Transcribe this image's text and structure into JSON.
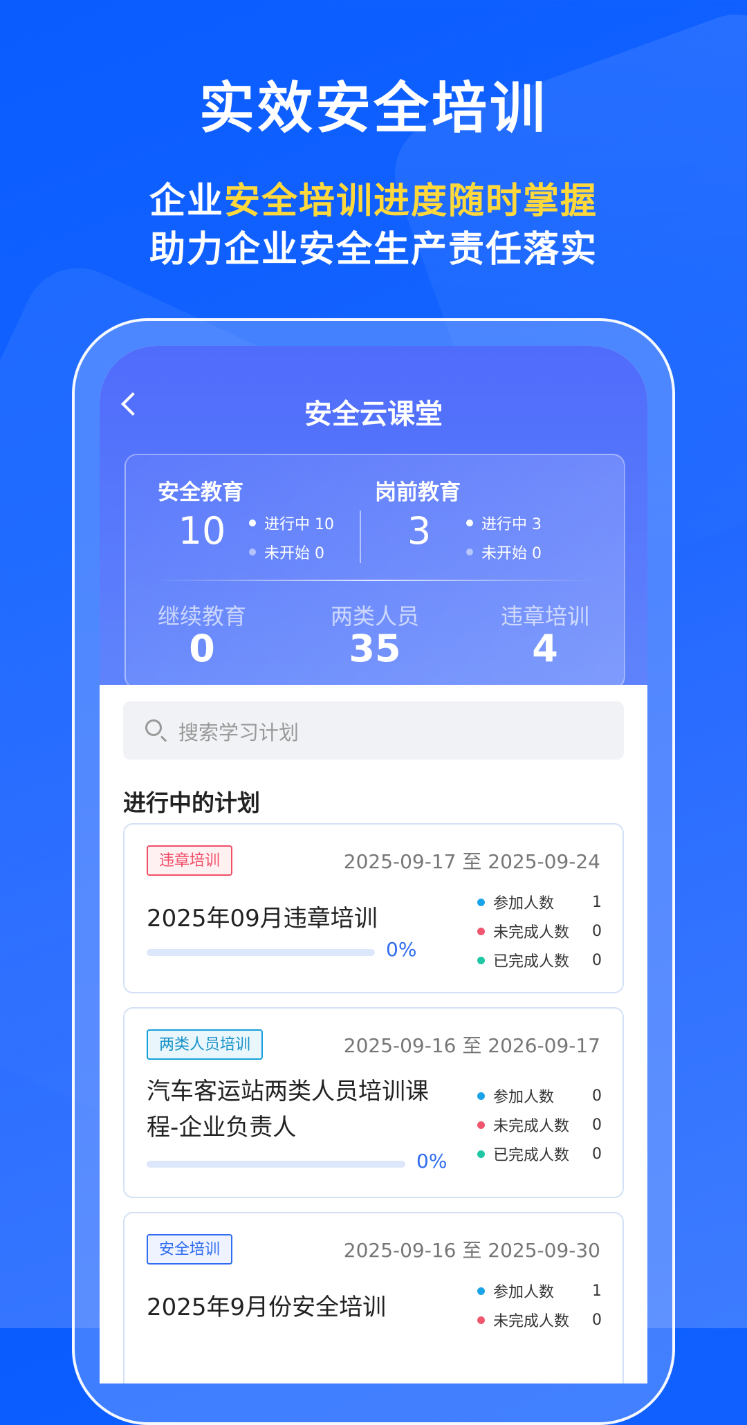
{
  "hero": {
    "title": "实效安全培训",
    "line1_prefix": "企业",
    "line1_highlight": "安全培训进度随时掌握",
    "line2": "助力企业安全生产责任落实",
    "highlight_color": "#ffd93b"
  },
  "app": {
    "title": "安全云课堂",
    "back_icon": "chevron-left-icon"
  },
  "summary": {
    "safety_edu": {
      "label": "安全教育",
      "total": "10",
      "in_progress": "进行中 10",
      "not_started": "未开始 0"
    },
    "pre_job_edu": {
      "label": "岗前教育",
      "total": "3",
      "in_progress": "进行中 3",
      "not_started": "未开始 0"
    },
    "continuing_edu": {
      "label": "继续教育",
      "value": "0"
    },
    "two_types": {
      "label": "两类人员",
      "value": "35"
    },
    "violation": {
      "label": "违章培训",
      "value": "4"
    }
  },
  "search": {
    "placeholder": "搜索学习计划"
  },
  "section_title": "进行中的计划",
  "plans": [
    {
      "tag": "违章培训",
      "dates": "2025-09-17 至 2025-09-24",
      "title_line1": "2025年09月违章培训",
      "title_line2": "",
      "progress_text": "0%",
      "progress": 0,
      "stats": [
        {
          "label": "参加人数",
          "value": "1"
        },
        {
          "label": "未完成人数",
          "value": "0"
        },
        {
          "label": "已完成人数",
          "value": "0"
        }
      ]
    },
    {
      "tag": "两类人员培训",
      "dates": "2025-09-16 至 2026-09-17",
      "title_line1": "汽车客运站两类人员培训课",
      "title_line2": "程-企业负责人",
      "progress_text": "0%",
      "progress": 0,
      "stats": [
        {
          "label": "参加人数",
          "value": "0"
        },
        {
          "label": "未完成人数",
          "value": "0"
        },
        {
          "label": "已完成人数",
          "value": "0"
        }
      ]
    },
    {
      "tag": "安全培训",
      "dates": "2025-09-16 至 2025-09-30",
      "title_line1": "2025年9月份安全培训",
      "title_line2": "",
      "progress_text": "",
      "progress": 0,
      "stats": [
        {
          "label": "参加人数",
          "value": "1"
        },
        {
          "label": "未完成人数",
          "value": "0"
        }
      ]
    }
  ],
  "colors": {
    "accent": "#2f6cf0",
    "dot_total": "#1aa3e8",
    "dot_incomplete": "#f0566e",
    "dot_complete": "#1fc7a5"
  }
}
